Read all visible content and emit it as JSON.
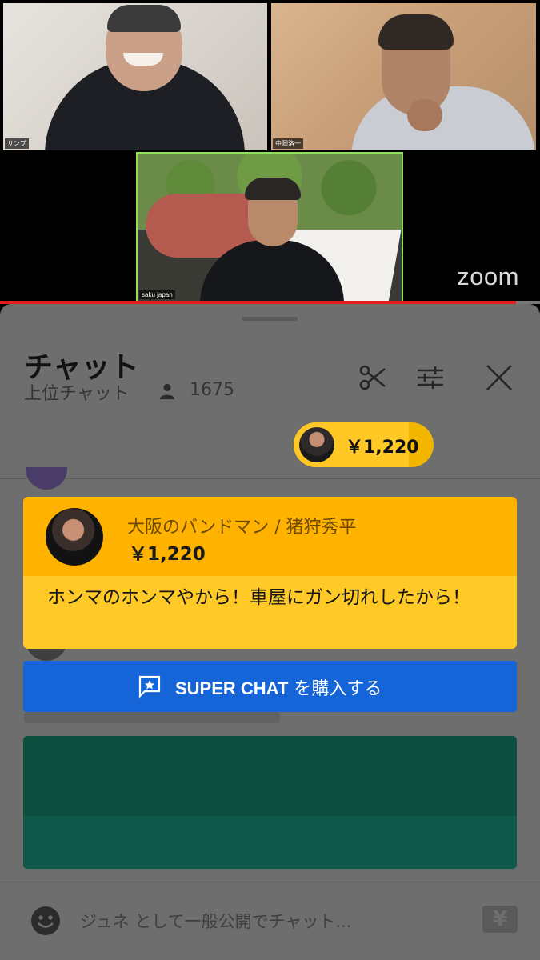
{
  "video": {
    "participants": [
      {
        "name": "サンプ"
      },
      {
        "name": "中岡洛一"
      },
      {
        "name": "saku japan"
      }
    ],
    "logo_text": "zoom",
    "progress_fraction": 0.955
  },
  "chat": {
    "title": "チャット",
    "subtitle": "上位チャット",
    "viewer_count": "1675",
    "ticker": {
      "amount": "￥1,220",
      "fill_fraction": 0.82
    },
    "super_chat": {
      "author": "大阪のバンドマン / 猪狩秀平",
      "amount": "￥1,220",
      "message": "ホンマのホンマやから！車屋にガン切れしたから！",
      "head_color": "#ffb300",
      "body_color": "#ffca28"
    },
    "buy_button": {
      "label_bold": "SUPER CHAT",
      "label_rest": " を購入する",
      "color": "#1565d8"
    },
    "input": {
      "placeholder": "ジュネ として一般公開でチャット..."
    },
    "yen_label": "¥"
  },
  "icons": [
    "person-icon",
    "scissors-icon",
    "tune-icon",
    "close-icon",
    "super-chat-icon",
    "emoji-icon",
    "yen-icon"
  ]
}
